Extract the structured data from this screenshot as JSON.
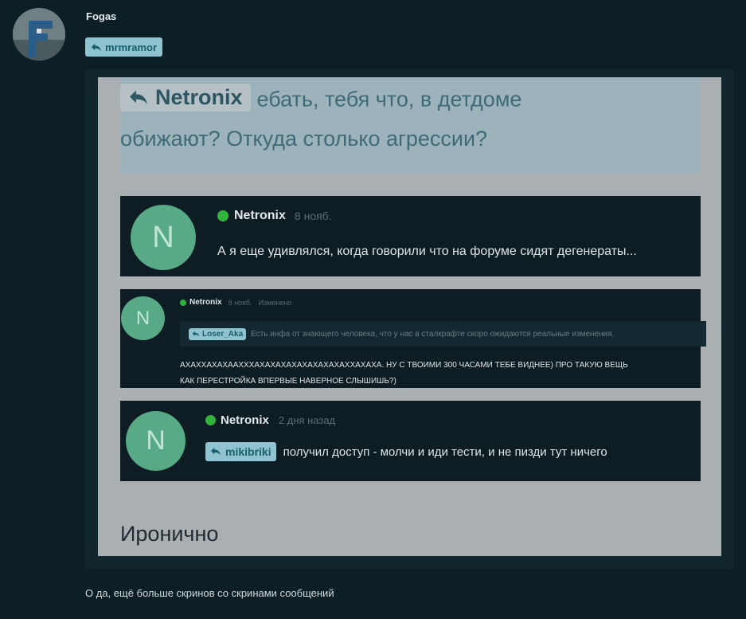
{
  "post": {
    "author": "Fogas",
    "reply_to": "mrmramor",
    "caption": "О да, ещё больше скринов со скринами сообщений",
    "avatar_icon": "user-avatar-f-logo"
  },
  "screenshot": {
    "quote": {
      "author": "Netronix",
      "line1": "ебать, тебя что, в детдоме",
      "line2": "обижают? Откуда столько агрессии?"
    },
    "comment1": {
      "avatar_letter": "N",
      "author": "Netronix",
      "time": "8 нояб.",
      "text": "А я еще удивлялся, когда говорили что на форуме сидят дегенераты..."
    },
    "comment2": {
      "avatar_letter": "N",
      "author": "Netronix",
      "time": "8 нояб.",
      "edited": "Изменено",
      "quote_author": "Loser_Aka",
      "quote_text": "Есть инфа от знающего человека, что у нас в сталкрафте скоро ожидаются реальные изменения.",
      "text_line1": "АХАХХАХАХААХХХАХАХАХАХАХАХАХАХАХХАХАХА. НУ С ТВОИМИ 300 ЧАСАМИ ТЕБЕ ВИДНЕЕ) ПРО ТАКУЮ ВЕЩЬ",
      "text_line2": "КАК ПЕРЕСТРОЙКА ВПЕРВЫЕ НАВЕРНОЕ СЛЫШИШЬ?)"
    },
    "comment3": {
      "avatar_letter": "N",
      "author": "Netronix",
      "time": "2 дня назад",
      "reply_to": "mikibriki",
      "text": "получил доступ - молчи и иди тести, и не пизди тут ничего"
    },
    "bottom_text": "Иронично"
  },
  "colors": {
    "page_bg": "#0d1f26",
    "reply_chip": "#8fc3cf",
    "online": "#32b33d",
    "avatar_green": "#58aa87"
  }
}
